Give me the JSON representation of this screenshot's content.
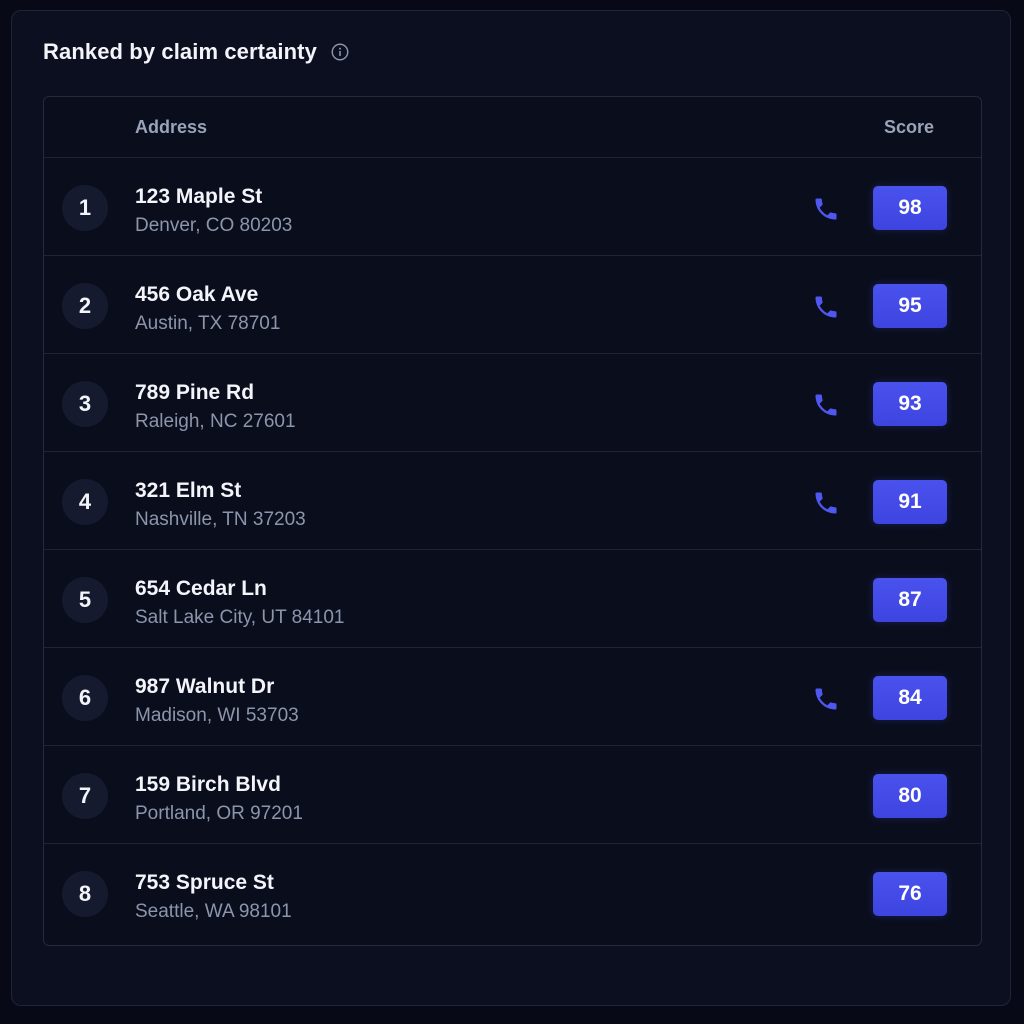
{
  "header": {
    "title": "Ranked by claim certainty",
    "info_icon": "info-icon"
  },
  "table": {
    "columns": {
      "address": "Address",
      "score": "Score"
    },
    "rows": [
      {
        "rank": "1",
        "street": "123 Maple St",
        "city": "Denver, CO 80203",
        "phone": true,
        "score": "98"
      },
      {
        "rank": "2",
        "street": "456 Oak Ave",
        "city": "Austin, TX 78701",
        "phone": true,
        "score": "95"
      },
      {
        "rank": "3",
        "street": "789 Pine Rd",
        "city": "Raleigh, NC 27601",
        "phone": true,
        "score": "93"
      },
      {
        "rank": "4",
        "street": "321 Elm St",
        "city": "Nashville, TN 37203",
        "phone": true,
        "score": "91"
      },
      {
        "rank": "5",
        "street": "654 Cedar Ln",
        "city": "Salt Lake City, UT 84101",
        "phone": false,
        "score": "87"
      },
      {
        "rank": "6",
        "street": "987 Walnut Dr",
        "city": "Madison, WI 53703",
        "phone": true,
        "score": "84"
      },
      {
        "rank": "7",
        "street": "159 Birch Blvd",
        "city": "Portland, OR 97201",
        "phone": false,
        "score": "80"
      },
      {
        "rank": "8",
        "street": "753 Spruce St",
        "city": "Seattle, WA 98101",
        "phone": false,
        "score": "76"
      }
    ]
  },
  "colors": {
    "background": "#070a16",
    "panel": "#0b0f1f",
    "accent": "#4a52ee",
    "phone_icon": "#4f57f0",
    "text_primary": "#f3f5fa",
    "text_secondary": "#8c95ab"
  }
}
